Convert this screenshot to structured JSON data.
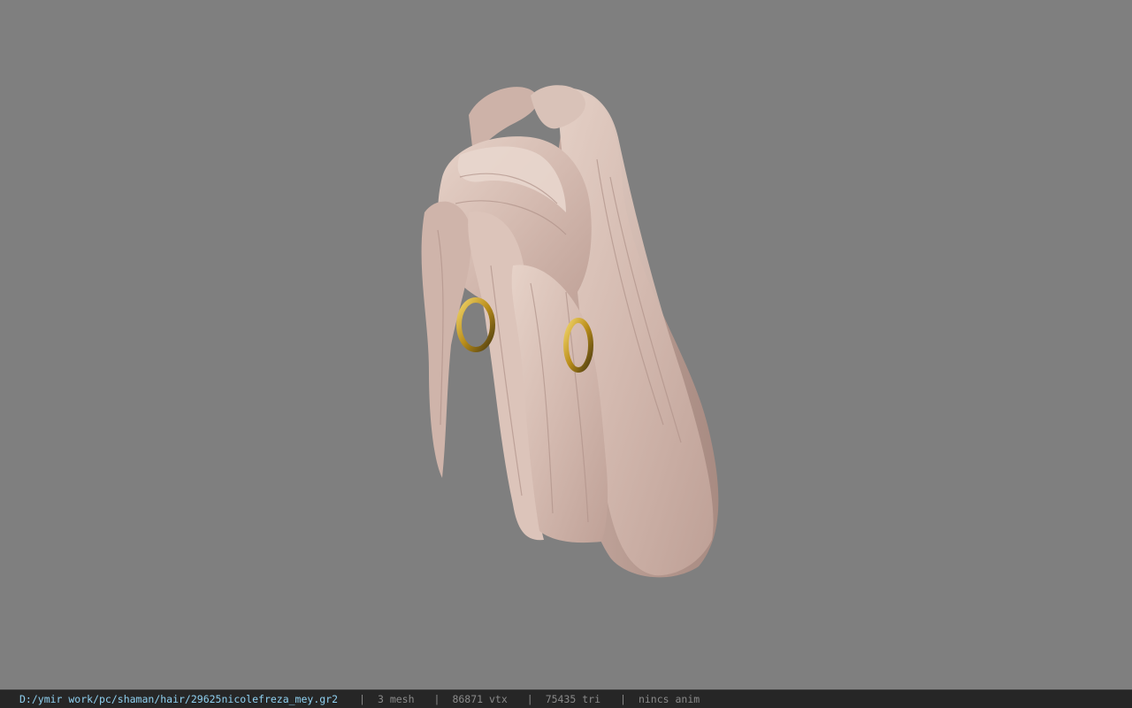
{
  "viewer": {
    "background_color": "#7f7f7f",
    "model_subject": "hair-mesh",
    "hair_color": "#d8c0b6",
    "earring_color": "#c9a227"
  },
  "statusbar": {
    "path": "D:/ymir work/pc/shaman/hair/29625nicolefreza_mey.gr2",
    "separator": "|",
    "mesh": "3 mesh",
    "vtx": "86871 vtx",
    "tri": "75435 tri",
    "anim": "nincs anim",
    "path_color": "#8fd0f0",
    "text_color": "#8a8a8a"
  }
}
